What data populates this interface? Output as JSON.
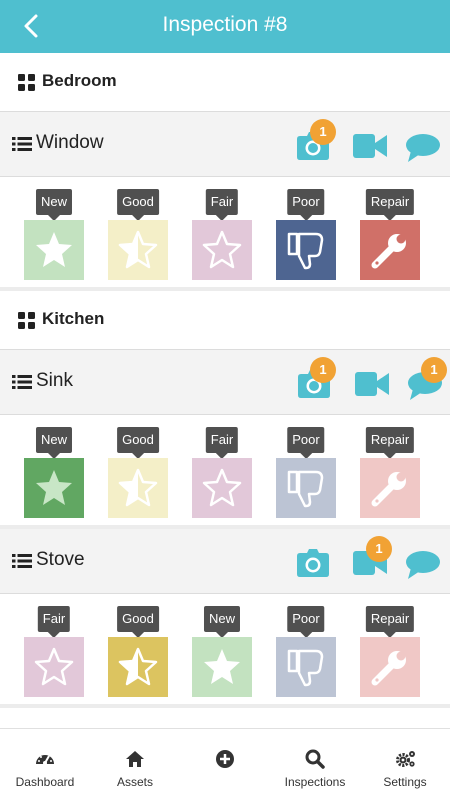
{
  "header": {
    "title": "Inspection #8",
    "back_icon": "chevron-left-icon",
    "color": "#4fbfcf"
  },
  "rooms": [
    {
      "name": "Bedroom",
      "items": [
        {
          "name": "Window",
          "photo_badge": "1",
          "video_badge": "",
          "comment_badge": "",
          "ratings": [
            {
              "label": "New",
              "color": "#c3e2c0",
              "icon": "star-icon",
              "selected": false
            },
            {
              "label": "Good",
              "color": "#f4efc8",
              "icon": "half-star-icon",
              "selected": false
            },
            {
              "label": "Fair",
              "color": "#e2c8d9",
              "icon": "star-outline-icon",
              "selected": false
            },
            {
              "label": "Poor",
              "color": "#4e6591",
              "icon": "thumbs-down-icon",
              "selected": true
            },
            {
              "label": "Repair",
              "color": "#d07068",
              "icon": "wrench-icon",
              "selected": true
            }
          ]
        }
      ]
    },
    {
      "name": "Kitchen",
      "items": [
        {
          "name": "Sink",
          "photo_badge": "1",
          "video_badge": "",
          "comment_badge": "1",
          "ratings": [
            {
              "label": "New",
              "color": "#61a762",
              "icon": "star-icon",
              "selected": true
            },
            {
              "label": "Good",
              "color": "#f4efc8",
              "icon": "half-star-icon",
              "selected": false
            },
            {
              "label": "Fair",
              "color": "#e2c8d9",
              "icon": "star-outline-icon",
              "selected": false
            },
            {
              "label": "Poor",
              "color": "#bcc4d4",
              "icon": "thumbs-down-icon",
              "selected": false
            },
            {
              "label": "Repair",
              "color": "#f0c8c6",
              "icon": "wrench-icon",
              "selected": false
            }
          ]
        },
        {
          "name": "Stove",
          "photo_badge": "",
          "video_badge": "1",
          "comment_badge": "",
          "ratings": [
            {
              "label": "Fair",
              "color": "#e2c8d9",
              "icon": "star-outline-icon",
              "selected": false
            },
            {
              "label": "Good",
              "color": "#dcc460",
              "icon": "half-star-icon",
              "selected": true
            },
            {
              "label": "New",
              "color": "#c3e2c0",
              "icon": "star-icon",
              "selected": false
            },
            {
              "label": "Poor",
              "color": "#bcc4d4",
              "icon": "thumbs-down-icon",
              "selected": false
            },
            {
              "label": "Repair",
              "color": "#f0c8c6",
              "icon": "wrench-icon",
              "selected": false
            }
          ]
        }
      ]
    }
  ],
  "bottom_nav": [
    {
      "label": "Dashboard",
      "icon": "speedometer-icon"
    },
    {
      "label": "Assets",
      "icon": "home-icon"
    },
    {
      "label": "",
      "icon": "plus-circle-icon"
    },
    {
      "label": "Inspections",
      "icon": "search-icon"
    },
    {
      "label": "Settings",
      "icon": "gears-icon"
    }
  ]
}
